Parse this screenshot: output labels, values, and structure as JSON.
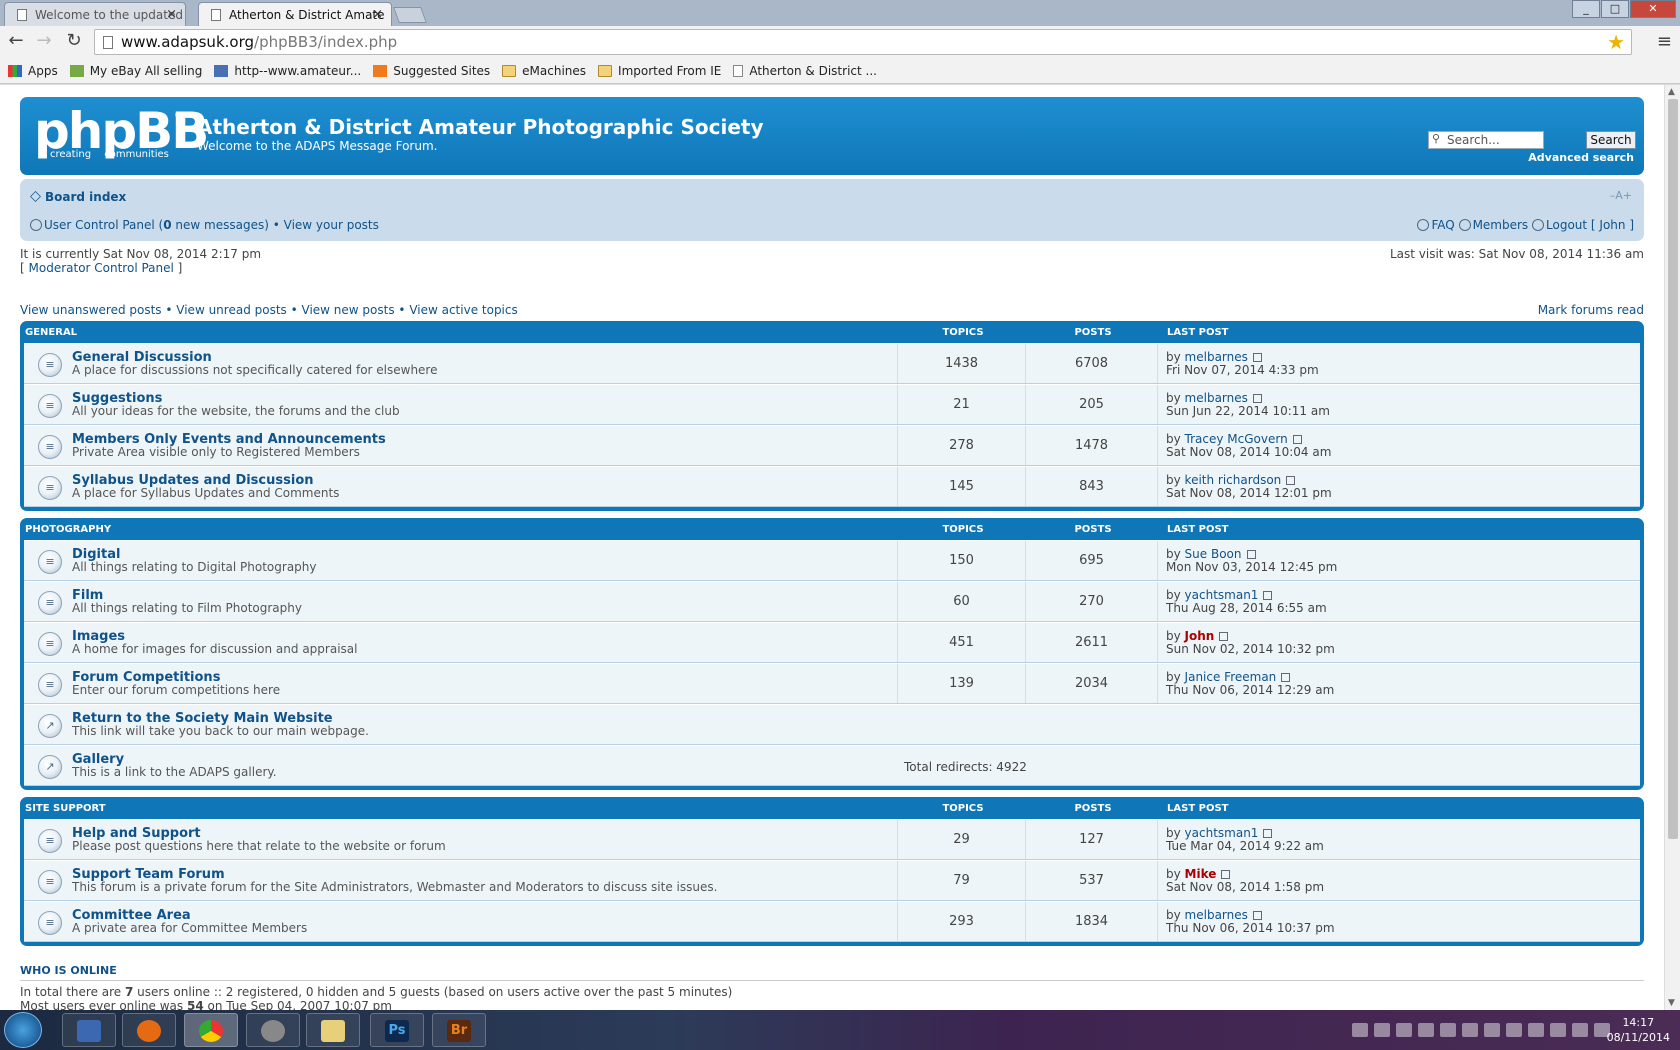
{
  "browser": {
    "tabs": [
      {
        "title": "Welcome to the updated |",
        "active": false
      },
      {
        "title": "Atherton & District Amate",
        "active": true
      }
    ],
    "url_domain": "www.adapsuk.org",
    "url_path": "/phpBB3/index.php",
    "bookmarks": [
      {
        "label": "Apps",
        "icon": "apps-icon"
      },
      {
        "label": "My eBay All selling",
        "icon": "ebay-icon"
      },
      {
        "label": "http--www.amateur...",
        "icon": "camera-icon"
      },
      {
        "label": "Suggested Sites",
        "icon": "suggested-sites-icon"
      },
      {
        "label": "eMachines",
        "icon": "folder-icon"
      },
      {
        "label": "Imported From IE",
        "icon": "folder-icon"
      },
      {
        "label": "Atherton & District ...",
        "icon": "page-icon"
      }
    ]
  },
  "header": {
    "logo_text": "phpBB",
    "logo_sub": "creating communities",
    "site_title": "Atherton & District Amateur Photographic Society",
    "site_description": "Welcome to the ADAPS Message Forum.",
    "search_placeholder": "Search...",
    "search_button": "Search",
    "advanced_search": "Advanced search"
  },
  "navbar": {
    "breadcrumb": "Board index",
    "font_size_control": "–A+",
    "ucp_label": "User Control Panel",
    "ucp_count": "0",
    "ucp_suffix": "new messages)",
    "view_posts": "View your posts",
    "faq": "FAQ",
    "members": "Members",
    "logout": "Logout [ John ]"
  },
  "info": {
    "current_time": "It is currently Sat Nov 08, 2014 2:17 pm",
    "mod_panel": "Moderator Control Panel",
    "last_visit": "Last visit was: Sat Nov 08, 2014 11:36 am",
    "quicklinks": [
      "View unanswered posts",
      "View unread posts",
      "View new posts",
      "View active topics"
    ],
    "mark_read": "Mark forums read"
  },
  "columns": {
    "topics": "TOPICS",
    "posts": "POSTS",
    "last_post": "LAST POST"
  },
  "categories": [
    {
      "name": "GENERAL",
      "forums": [
        {
          "title": "General Discussion",
          "desc": "A place for discussions not specifically catered for elsewhere",
          "topics": "1438",
          "posts": "6708",
          "by": "melbarnes",
          "date": "Fri Nov 07, 2014 4:33 pm"
        },
        {
          "title": "Suggestions",
          "desc": "All your ideas for the website, the forums and the club",
          "topics": "21",
          "posts": "205",
          "by": "melbarnes",
          "date": "Sun Jun 22, 2014 10:11 am"
        },
        {
          "title": "Members Only Events and Announcements",
          "desc": "Private Area visible only to Registered Members",
          "topics": "278",
          "posts": "1478",
          "by": "Tracey McGovern",
          "date": "Sat Nov 08, 2014 10:04 am"
        },
        {
          "title": "Syllabus Updates and Discussion",
          "desc": "A place for Syllabus Updates and Comments",
          "topics": "145",
          "posts": "843",
          "by": "keith richardson",
          "date": "Sat Nov 08, 2014 12:01 pm"
        }
      ]
    },
    {
      "name": "PHOTOGRAPHY",
      "forums": [
        {
          "title": "Digital",
          "desc": "All things relating to Digital Photography",
          "topics": "150",
          "posts": "695",
          "by": "Sue Boon",
          "date": "Mon Nov 03, 2014 12:45 pm"
        },
        {
          "title": "Film",
          "desc": "All things relating to Film Photography",
          "topics": "60",
          "posts": "270",
          "by": "yachtsman1",
          "date": "Thu Aug 28, 2014 6:55 am"
        },
        {
          "title": "Images",
          "desc": "A home for images for discussion and appraisal",
          "topics": "451",
          "posts": "2611",
          "by": "John",
          "by_highlight": true,
          "date": "Sun Nov 02, 2014 10:32 pm"
        },
        {
          "title": "Forum Competitions",
          "desc": "Enter our forum competitions here",
          "topics": "139",
          "posts": "2034",
          "by": "Janice Freeman",
          "date": "Thu Nov 06, 2014 12:29 am"
        },
        {
          "title": "Return to the Society Main Website",
          "desc": "This link will take you back to our main webpage.",
          "link": true
        },
        {
          "title": "Gallery",
          "desc": "This is a link to the ADAPS gallery.",
          "link": true,
          "redirects": "Total redirects: 4922"
        }
      ]
    },
    {
      "name": "SITE SUPPORT",
      "forums": [
        {
          "title": "Help and Support",
          "desc": "Please post questions here that relate to the website or forum",
          "topics": "29",
          "posts": "127",
          "by": "yachtsman1",
          "date": "Tue Mar 04, 2014 9:22 am"
        },
        {
          "title": "Support Team Forum",
          "desc": "This forum is a private forum for the Site Administrators, Webmaster and Moderators to discuss site issues.",
          "topics": "79",
          "posts": "537",
          "by": "Mike",
          "by_highlight": true,
          "date": "Sat Nov 08, 2014 1:58 pm"
        },
        {
          "title": "Committee Area",
          "desc": "A private area for Committee Members",
          "topics": "293",
          "posts": "1834",
          "by": "melbarnes",
          "date": "Thu Nov 06, 2014 10:37 pm"
        }
      ]
    }
  ],
  "who_online": {
    "title": "WHO IS ONLINE",
    "line1_a": "In total there are ",
    "line1_count": "7",
    "line1_b": " users online :: 2 registered, 0 hidden and 5 guests (based on users active over the past 5 minutes)",
    "line2_a": "Most users ever online was ",
    "line2_count": "54",
    "line2_b": " on Tue Sep 04, 2007 10:07 pm"
  },
  "taskbar": {
    "apps": [
      {
        "name": "file-manager",
        "label": ""
      },
      {
        "name": "firefox",
        "label": ""
      },
      {
        "name": "chrome",
        "label": "",
        "active": true
      },
      {
        "name": "settings",
        "label": ""
      },
      {
        "name": "explorer",
        "label": ""
      },
      {
        "name": "photoshop",
        "label": "Ps"
      },
      {
        "name": "bridge",
        "label": "Br"
      }
    ],
    "time": "14:17",
    "date": "08/11/2014"
  },
  "colors": {
    "header_blue": "#0e77b8",
    "link": "#105289",
    "highlight_user": "#aa0000"
  }
}
